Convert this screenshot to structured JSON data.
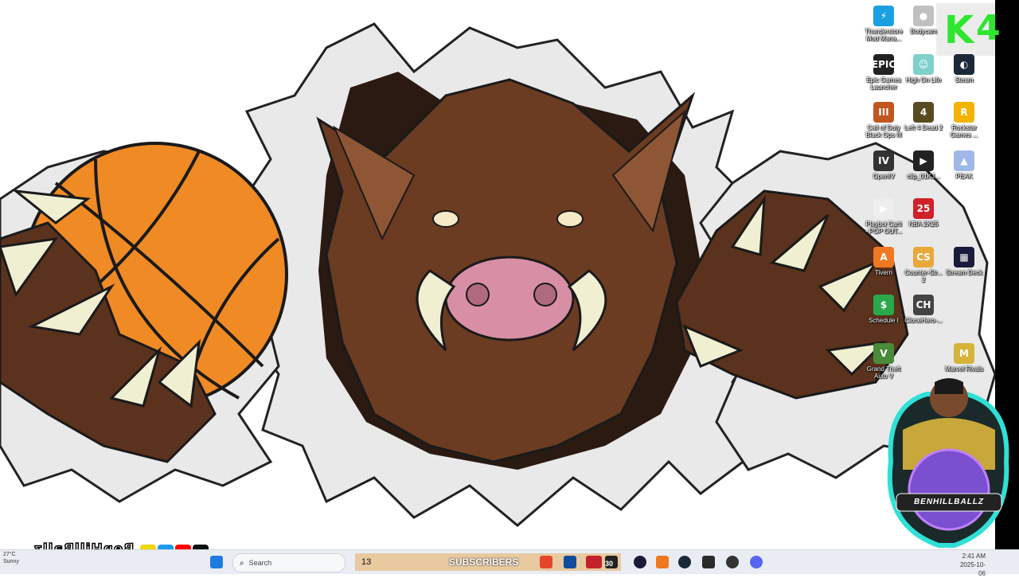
{
  "desktop_icons": [
    {
      "name": "thunderstore",
      "label": "Thunderstore\nMod Mana...",
      "glyph": "⚡",
      "color": "#1b9fe0"
    },
    {
      "name": "bodycam",
      "label": "Bodycam",
      "glyph": "●",
      "color": "#c0c0c0"
    },
    {
      "name": "epic",
      "label": "Epic Games\nLauncher",
      "glyph": "EPIC",
      "color": "#222222"
    },
    {
      "name": "high-on-life",
      "label": "High On Life",
      "glyph": "☺",
      "color": "#7fd1c9"
    },
    {
      "name": "steam",
      "label": "Steam",
      "glyph": "◐",
      "color": "#1b2838"
    },
    {
      "name": "cod",
      "label": "Call of Duty\nBlack Ops III",
      "glyph": "III",
      "color": "#c1561f"
    },
    {
      "name": "l4d2",
      "label": "Left 4 Dead 2",
      "glyph": "4",
      "color": "#5a4a22"
    },
    {
      "name": "rockstar",
      "label": "Rockstar\nGames ...",
      "glyph": "R",
      "color": "#f2b200"
    },
    {
      "name": "openiv",
      "label": "OpenIV",
      "glyph": "IV",
      "color": "#333333"
    },
    {
      "name": "clip",
      "label": "clip_01KJ...",
      "glyph": "▶",
      "color": "#222222"
    },
    {
      "name": "peak",
      "label": "PEAK",
      "glyph": "▲",
      "color": "#9fb8e8"
    },
    {
      "name": "playboi",
      "label": "Playboi Carti\n- POP OUT...",
      "glyph": "▶",
      "color": "#eeeeee"
    },
    {
      "name": "nba",
      "label": "NBA 2K25",
      "glyph": "25",
      "color": "#d0202a"
    },
    {
      "name": "tivern",
      "label": "Tivern",
      "glyph": "A",
      "color": "#f07820"
    },
    {
      "name": "counter-strike",
      "label": "Counter-Str...\n2",
      "glyph": "CS",
      "color": "#e8a93a"
    },
    {
      "name": "stream-deck",
      "label": "Stream Deck",
      "glyph": "▦",
      "color": "#1a1a3a"
    },
    {
      "name": "schedule",
      "label": "Schedule I",
      "glyph": "$",
      "color": "#2aa84a"
    },
    {
      "name": "clonehero",
      "label": "CloneHero-...",
      "glyph": "CH",
      "color": "#444444"
    },
    {
      "name": "gta",
      "label": "Grand Theft\nAuto V",
      "glyph": "V",
      "color": "#4a8a3a"
    },
    {
      "name": "marvel",
      "label": "Marvel Rivals",
      "glyph": "M",
      "color": "#d6b33a"
    }
  ],
  "overlay": {
    "k_letter": "K",
    "k_number": "4",
    "channel_name": "BenHillBallz",
    "avatar_text": "BENHILLBALLZ"
  },
  "taskbar": {
    "weather_temp": "27°C",
    "weather_desc": "Sunny",
    "search_placeholder": "Search",
    "subscriber_count": "13",
    "subscriber_label": "SUBSCRIBERS",
    "badge_30": "30",
    "clock_time": "2:41 AM",
    "clock_date": "2025-10-06"
  },
  "colors": {
    "taskbar_bg": "#e9edf3",
    "accent_green": "#2ee62e",
    "boar_brown": "#6b3b22",
    "ball_orange": "#f08a24"
  }
}
